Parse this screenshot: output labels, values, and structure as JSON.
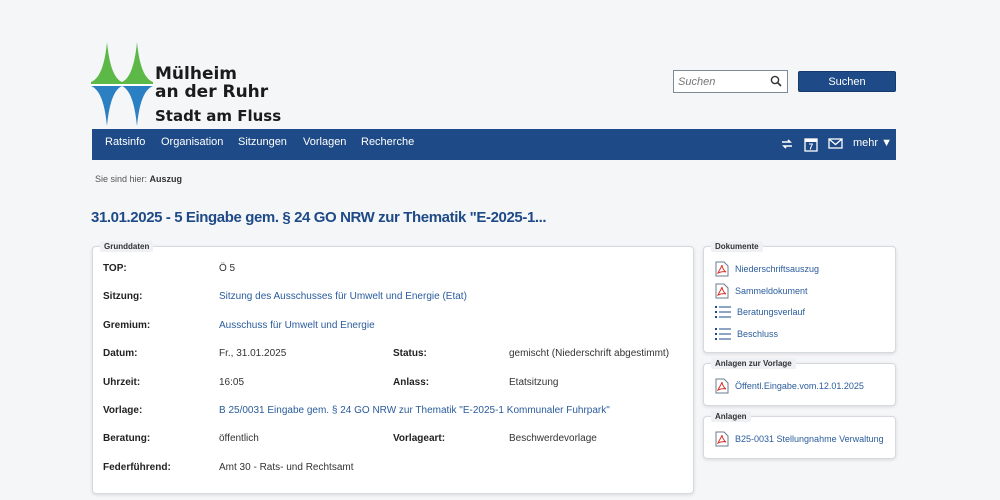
{
  "logo": {
    "line1": "Mülheim",
    "line2": "an der Ruhr",
    "line3": "Stadt am Fluss",
    "colors": {
      "green": "#5cb947",
      "blue": "#2b7fc3"
    }
  },
  "search": {
    "placeholder": "Suchen",
    "button_label": "Suchen"
  },
  "nav": {
    "items": [
      "Ratsinfo",
      "Organisation",
      "Sitzungen",
      "Vorlagen",
      "Recherche"
    ],
    "more_label": "mehr ▼",
    "tools": [
      "refresh-icon",
      "calendar-icon",
      "mail-icon"
    ],
    "calendar_day": "7"
  },
  "breadcrumb": {
    "prefix": "Sie sind hier:",
    "current": "Auszug"
  },
  "page_title": "31.01.2025 - 5 Eingabe gem. § 24 GO NRW zur Thematik \"E-2025-1...",
  "grunddaten": {
    "legend": "Grunddaten",
    "top_label": "TOP:",
    "top_value": "Ö 5",
    "sitzung_label": "Sitzung:",
    "sitzung_value": "Sitzung des Ausschusses für Umwelt und Energie (Etat)",
    "gremium_label": "Gremium:",
    "gremium_value": "Ausschuss für Umwelt und Energie",
    "datum_label": "Datum:",
    "datum_value": "Fr., 31.01.2025",
    "status_label": "Status:",
    "status_value": "gemischt (Niederschrift abgestimmt)",
    "uhrzeit_label": "Uhrzeit:",
    "uhrzeit_value": "16:05",
    "anlass_label": "Anlass:",
    "anlass_value": "Etatsitzung",
    "vorlage_label": "Vorlage:",
    "vorlage_value": "B 25/0031 Eingabe gem. § 24 GO NRW zur Thematik \"E-2025-1 Kommunaler Fuhrpark\"",
    "beratung_label": "Beratung:",
    "beratung_value": "öffentlich",
    "vorlageart_label": "Vorlageart:",
    "vorlageart_value": "Beschwerdevorlage",
    "feder_label": "Federführend:",
    "feder_value": "Amt 30 - Rats- und Rechtsamt"
  },
  "dokumente": {
    "legend": "Dokumente",
    "items": [
      "Niederschriftsauszug",
      "Sammeldokument",
      "Beratungsverlauf",
      "Beschluss"
    ]
  },
  "anlagen_vorlage": {
    "legend": "Anlagen zur Vorlage",
    "items": [
      "Öffentl.Eingabe.vom.12.01.2025"
    ]
  },
  "anlagen": {
    "legend": "Anlagen",
    "items": [
      "B25-0031 Stellungnahme Verwaltung"
    ]
  }
}
